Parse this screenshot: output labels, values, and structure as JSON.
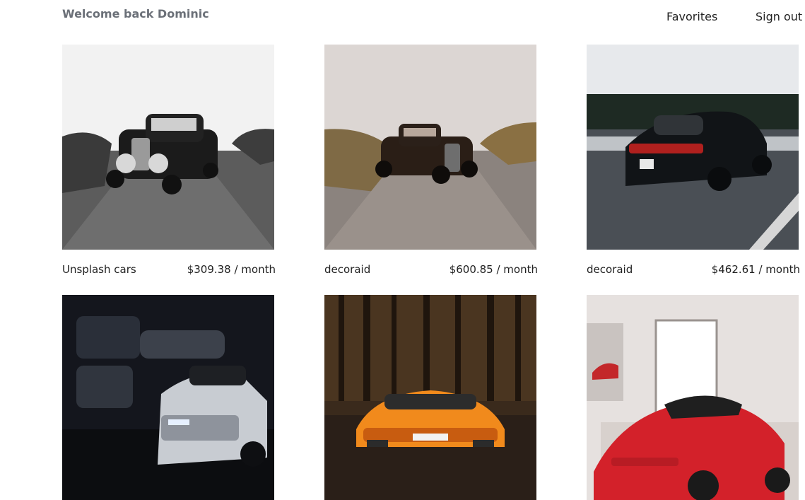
{
  "header": {
    "welcome": "Welcome back Dominic",
    "nav": {
      "favorites": "Favorites",
      "sign_out": "Sign out"
    }
  },
  "listings": [
    {
      "owner": "Unsplash cars",
      "price": "$309.38 / month",
      "image": "bw-hot-rod"
    },
    {
      "owner": "decoraid",
      "price": "$600.85 / month",
      "image": "hot-rod-road"
    },
    {
      "owner": "decoraid",
      "price": "$462.61 / month",
      "image": "black-porsche"
    },
    {
      "owner": "",
      "price": "",
      "image": "white-camaro-garage"
    },
    {
      "owner": "",
      "price": "",
      "image": "orange-lamborghini-forest"
    },
    {
      "owner": "",
      "price": "",
      "image": "red-ferrari-showroom"
    }
  ]
}
